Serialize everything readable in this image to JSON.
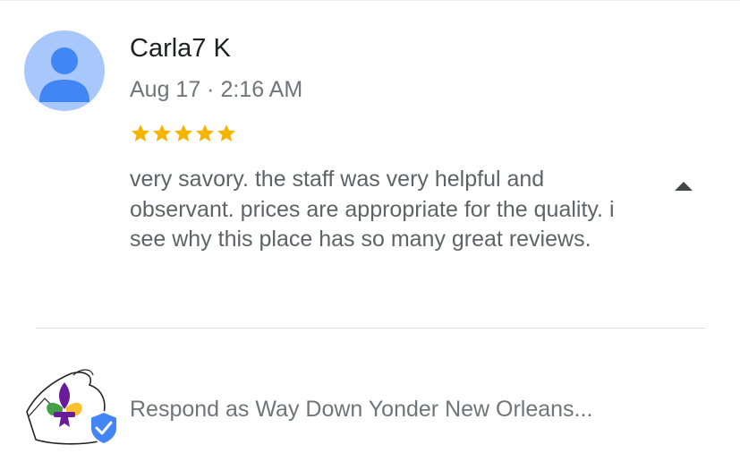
{
  "review": {
    "reviewer_name": "Carla7 K",
    "date": "Aug 17 · 2:16 AM",
    "rating": 5,
    "rating_max": 5,
    "star_color": "#f4b400",
    "text": "very savory. the staff was very helpful and observant. prices are appropriate for the quality. i see why this place has so many great reviews.",
    "avatar_icon": "person-icon",
    "avatar_color": "#a8c7fa",
    "avatar_figure_color": "#4285f4",
    "collapse_icon": "triangle-up-icon"
  },
  "response": {
    "prompt": "Respond as Way Down Yonder New Orleans...",
    "logo_icon": "fleur-de-lis-logo",
    "verified_icon": "verified-badge-icon",
    "verified_color": "#4285f4"
  }
}
